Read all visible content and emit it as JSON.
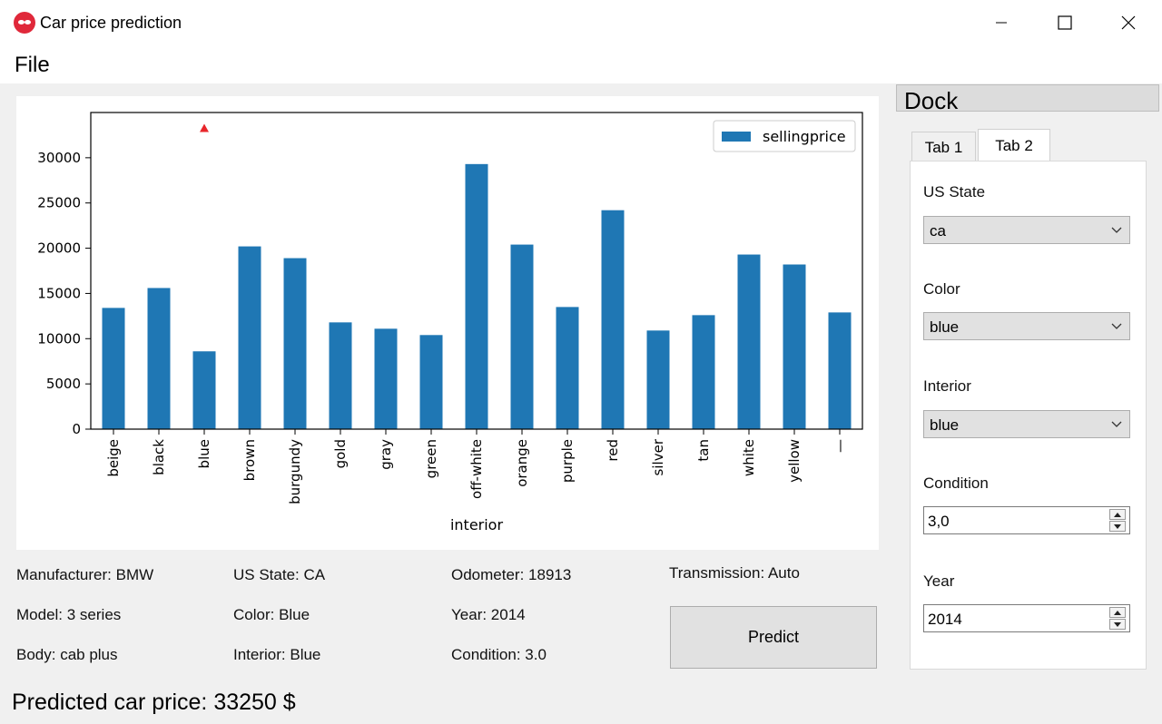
{
  "window": {
    "title": "Car price prediction"
  },
  "menu": {
    "file": "File"
  },
  "chart_data": {
    "type": "bar",
    "xlabel": "interior",
    "ylabel": "",
    "legend": [
      "sellingprice"
    ],
    "legend_position": "top-right",
    "ylim": [
      0,
      35000
    ],
    "yticks": [
      0,
      5000,
      10000,
      15000,
      20000,
      25000,
      30000
    ],
    "categories": [
      "beige",
      "black",
      "blue",
      "brown",
      "burgundy",
      "gold",
      "gray",
      "green",
      "off-white",
      "orange",
      "purple",
      "red",
      "silver",
      "tan",
      "white",
      "yellow",
      "—"
    ],
    "values": [
      13400,
      15600,
      8600,
      20200,
      18900,
      11800,
      11100,
      10400,
      29300,
      20400,
      13500,
      24200,
      10900,
      12600,
      19300,
      18200,
      12900
    ],
    "bar_color": "#1f77b4",
    "marker": {
      "category": "blue",
      "value": 33250,
      "color": "#e8262b"
    }
  },
  "info": {
    "manufacturer": "Manufacturer: BMW",
    "model": "Model: 3 series",
    "body": "Body: cab plus",
    "state": "US State: CA",
    "color": "Color: Blue",
    "interior": "Interior: Blue",
    "odometer": "Odometer: 18913",
    "year": "Year: 2014",
    "condition": "Condition: 3.0",
    "transmission": "Transmission: Auto"
  },
  "predict_label": "Predict",
  "predicted_text": "Predicted car price: 33250 $",
  "dock": {
    "title": "Dock",
    "tabs": [
      "Tab 1",
      "Tab 2"
    ],
    "active_tab": "Tab 2",
    "fields": {
      "state_label": "US State",
      "state_value": "ca",
      "color_label": "Color",
      "color_value": "blue",
      "interior_label": "Interior",
      "interior_value": "blue",
      "condition_label": "Condition",
      "condition_value": "3,0",
      "year_label": "Year",
      "year_value": "2014"
    }
  }
}
